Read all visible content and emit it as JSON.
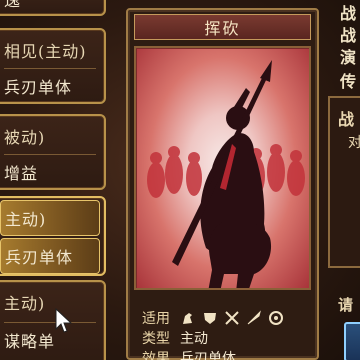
{
  "skill_list": {
    "top_partial": "逸",
    "group1": {
      "header": "相见(主动)",
      "detail": "兵刃单体"
    },
    "group2": {
      "header": "被动)",
      "detail": "增益"
    },
    "group3": {
      "header": "主动)",
      "detail": "兵刃单体"
    },
    "group4": {
      "header": "主动)",
      "detail": "谋略单"
    }
  },
  "card": {
    "title": "挥砍",
    "applicable_label": "适用",
    "applicable_icons": [
      "cavalry-icon",
      "shield-icon",
      "bow-icon",
      "spear-icon",
      "siege-icon"
    ],
    "type_label": "类型",
    "type_value": "主动",
    "effect_label": "效果",
    "effect_value": "兵刃单体"
  },
  "right_panel": {
    "stats": [
      "战",
      "战",
      "演",
      "传"
    ],
    "section_title": "战",
    "section_text": "对",
    "hint": "请"
  },
  "colors": {
    "accent_gold": "#b8924a",
    "title_red": "#7a3a30",
    "selected_gold": "#a67b2e"
  }
}
